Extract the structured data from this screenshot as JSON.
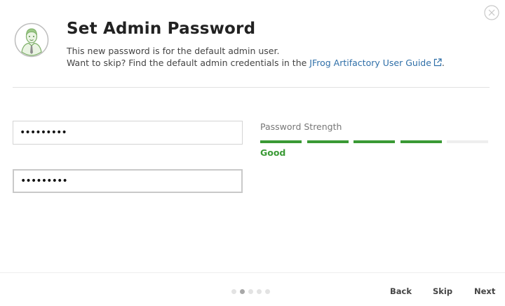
{
  "dialog": {
    "title": "Set Admin Password",
    "description_line1": "This new password is for the default admin user.",
    "description_line2_prefix": "Want to skip? Find the default admin credentials in the ",
    "guide_link": "JFrog Artifactory User Guide",
    "description_line2_suffix": "."
  },
  "form": {
    "password_value": "•••••••••",
    "confirm_value": "•••••••••"
  },
  "strength": {
    "label": "Password Strength",
    "value": "Good",
    "filled_segments": 4,
    "total_segments": 5,
    "color": "#3a9a35"
  },
  "pagination": {
    "total_steps": 5,
    "current_step": 2
  },
  "footer": {
    "back_label": "Back",
    "skip_label": "Skip",
    "next_label": "Next"
  },
  "icons": {
    "close": "close-circle-icon",
    "avatar": "admin-avatar-icon",
    "external_link": "external-link-icon"
  },
  "colors": {
    "link": "#2f6fa8",
    "strength_good": "#3a9a35",
    "avatar_green": "#8fbf7a"
  }
}
